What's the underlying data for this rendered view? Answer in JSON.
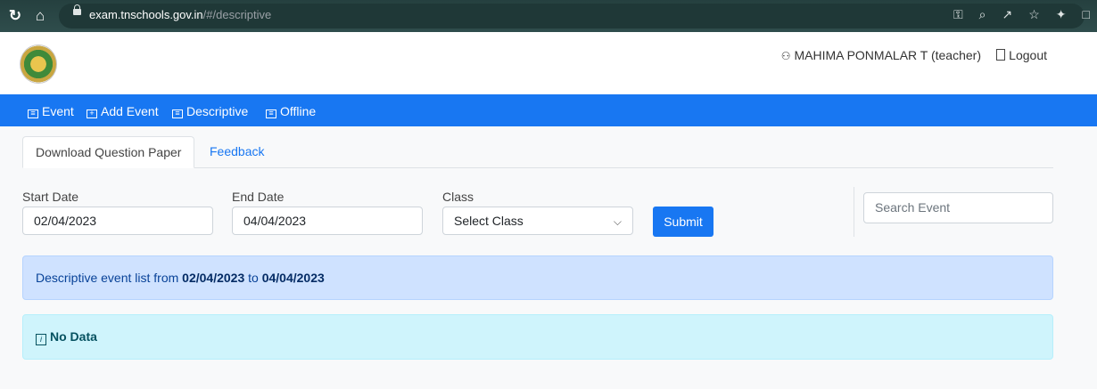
{
  "browser": {
    "url_host": "exam.tnschools.gov.in",
    "url_path": "/#/descriptive",
    "icons": [
      "reload-icon",
      "home-icon",
      "lock-icon",
      "key-icon",
      "zoom-icon",
      "share-icon",
      "star-icon",
      "extensions-icon",
      "sidepanel-icon"
    ]
  },
  "header": {
    "user_label": "MAHIMA PONMALAR T (teacher)",
    "logout_label": "Logout"
  },
  "menu": {
    "items": [
      {
        "label": "Event",
        "icon": "list-icon"
      },
      {
        "label": "Add Event",
        "icon": "plus-box-icon"
      },
      {
        "label": "Descriptive",
        "icon": "list-icon"
      },
      {
        "label": "Offline",
        "icon": "list-icon"
      }
    ]
  },
  "tabs": {
    "download": "Download Question Paper",
    "feedback": "Feedback"
  },
  "filters": {
    "start_label": "Start Date",
    "start_value": "02/04/2023",
    "end_label": "End Date",
    "end_value": "04/04/2023",
    "class_label": "Class",
    "class_value": "Select Class",
    "submit_label": "Submit",
    "search_placeholder": "Search Event"
  },
  "info": {
    "prefix": "Descriptive event list from ",
    "from": "02/04/2023",
    "mid": " to ",
    "to": "04/04/2023",
    "empty_text": "No Data"
  },
  "colors": {
    "primary": "#1877f2",
    "chrome_bar": "#2d4a4a",
    "alert_blue": "#cfe2ff",
    "alert_cyan": "#cff4fc"
  }
}
